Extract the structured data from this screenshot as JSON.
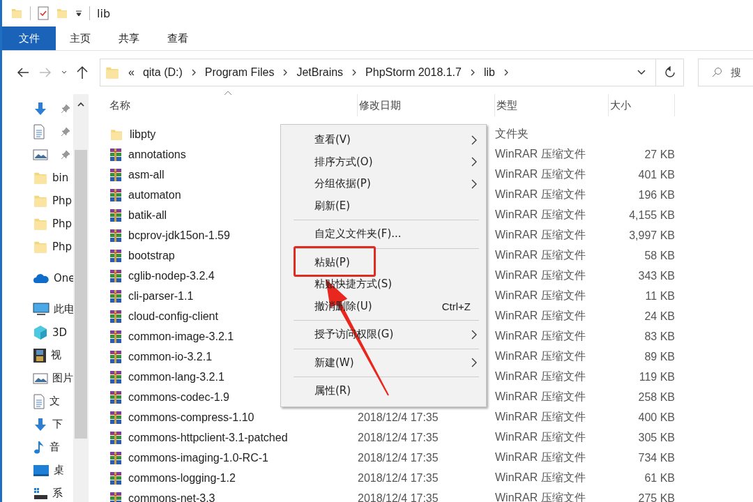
{
  "window": {
    "title": "lib"
  },
  "ribbon_tabs": [
    {
      "label": "文件",
      "selected": true
    },
    {
      "label": "主页",
      "selected": false
    },
    {
      "label": "共享",
      "selected": false
    },
    {
      "label": "查看",
      "selected": false
    }
  ],
  "address": {
    "overflow": "«",
    "segments": [
      "qita (D:)",
      "Program Files",
      "JetBrains",
      "PhpStorm 2018.1.7",
      "lib"
    ]
  },
  "search": {
    "placeholder": "搜"
  },
  "sidebar": {
    "items": [
      {
        "kind": "download",
        "pinned": true
      },
      {
        "kind": "document",
        "pinned": true
      },
      {
        "kind": "picture",
        "pinned": true
      },
      {
        "kind": "folder",
        "label": "bin",
        "pinned": false
      },
      {
        "kind": "folder",
        "label": "Php",
        "pinned": false
      },
      {
        "kind": "folder",
        "label": "Php",
        "pinned": false
      },
      {
        "kind": "folder",
        "label": "Php",
        "pinned": false
      },
      {
        "kind": "cloud",
        "label": "One",
        "pinned": false
      },
      {
        "kind": "computer",
        "label": "此电",
        "pinned": false
      },
      {
        "kind": "cube",
        "label": "3D",
        "pinned": false
      },
      {
        "kind": "video",
        "label": "视",
        "pinned": false
      },
      {
        "kind": "picture",
        "label": "图片",
        "pinned": false
      },
      {
        "kind": "document",
        "label": "文",
        "pinned": false
      },
      {
        "kind": "download",
        "label": "下",
        "pinned": false
      },
      {
        "kind": "music",
        "label": "音",
        "pinned": false
      },
      {
        "kind": "desktop",
        "label": "桌",
        "pinned": false
      },
      {
        "kind": "drive",
        "label": "系",
        "pinned": false
      }
    ]
  },
  "columns": [
    "名称",
    "修改日期",
    "类型",
    "大小"
  ],
  "rows": [
    {
      "kind": "folder",
      "name": "libpty",
      "type": "文件夹"
    },
    {
      "kind": "archive",
      "name": "annotations",
      "type": "WinRAR 压缩文件",
      "size": "27 KB"
    },
    {
      "kind": "archive",
      "name": "asm-all",
      "type": "WinRAR 压缩文件",
      "size": "401 KB"
    },
    {
      "kind": "archive",
      "name": "automaton",
      "type": "WinRAR 压缩文件",
      "size": "196 KB"
    },
    {
      "kind": "archive",
      "name": "batik-all",
      "type": "WinRAR 压缩文件",
      "size": "4,155 KB"
    },
    {
      "kind": "archive",
      "name": "bcprov-jdk15on-1.59",
      "type": "WinRAR 压缩文件",
      "size": "3,997 KB"
    },
    {
      "kind": "archive",
      "name": "bootstrap",
      "type": "WinRAR 压缩文件",
      "size": "58 KB"
    },
    {
      "kind": "archive",
      "name": "cglib-nodep-3.2.4",
      "type": "WinRAR 压缩文件",
      "size": "343 KB"
    },
    {
      "kind": "archive",
      "name": "cli-parser-1.1",
      "type": "WinRAR 压缩文件",
      "size": "11 KB"
    },
    {
      "kind": "archive",
      "name": "cloud-config-client",
      "type": "WinRAR 压缩文件",
      "size": "24 KB"
    },
    {
      "kind": "archive",
      "name": "common-image-3.2.1",
      "type": "WinRAR 压缩文件",
      "size": "83 KB"
    },
    {
      "kind": "archive",
      "name": "common-io-3.2.1",
      "type": "WinRAR 压缩文件",
      "size": "89 KB"
    },
    {
      "kind": "archive",
      "name": "common-lang-3.2.1",
      "type": "WinRAR 压缩文件",
      "size": "119 KB"
    },
    {
      "kind": "archive",
      "name": "commons-codec-1.9",
      "type": "WinRAR 压缩文件",
      "size": "258 KB"
    },
    {
      "kind": "archive",
      "name": "commons-compress-1.10",
      "modified": "2018/12/4 17:35",
      "type": "WinRAR 压缩文件",
      "size": "400 KB"
    },
    {
      "kind": "archive",
      "name": "commons-httpclient-3.1-patched",
      "modified": "2018/12/4 17:35",
      "type": "WinRAR 压缩文件",
      "size": "305 KB"
    },
    {
      "kind": "archive",
      "name": "commons-imaging-1.0-RC-1",
      "modified": "2018/12/4 17:35",
      "type": "WinRAR 压缩文件",
      "size": "734 KB"
    },
    {
      "kind": "archive",
      "name": "commons-logging-1.2",
      "modified": "2018/12/4 17:35",
      "type": "WinRAR 压缩文件",
      "size": "61 KB"
    },
    {
      "kind": "archive",
      "name": "commons-net-3.3",
      "modified": "2018/12/4 17:35",
      "type": "WinRAR 压缩文件",
      "size": "275 KB"
    }
  ],
  "context_menu": {
    "items": [
      {
        "kind": "item",
        "label": "查看(V)",
        "submenu": true,
        "highlighted": false
      },
      {
        "kind": "item",
        "label": "排序方式(O)",
        "submenu": true,
        "highlighted": false
      },
      {
        "kind": "item",
        "label": "分组依据(P)",
        "submenu": true,
        "highlighted": false
      },
      {
        "kind": "item",
        "label": "刷新(E)",
        "submenu": false,
        "highlighted": false
      },
      {
        "kind": "separator"
      },
      {
        "kind": "item",
        "label": "自定义文件夹(F)...",
        "submenu": false,
        "highlighted": false
      },
      {
        "kind": "separator"
      },
      {
        "kind": "item",
        "label": "粘贴(P)",
        "submenu": false,
        "highlighted": true
      },
      {
        "kind": "item",
        "label": "粘贴快捷方式(S)",
        "submenu": false,
        "highlighted": false
      },
      {
        "kind": "item",
        "label": "撤消删除(U)",
        "shortcut": "Ctrl+Z",
        "submenu": false,
        "highlighted": false
      },
      {
        "kind": "separator"
      },
      {
        "kind": "item",
        "label": "授予访问权限(G)",
        "submenu": true,
        "highlighted": false
      },
      {
        "kind": "separator"
      },
      {
        "kind": "item",
        "label": "新建(W)",
        "submenu": true,
        "highlighted": false
      },
      {
        "kind": "separator"
      },
      {
        "kind": "item",
        "label": "属性(R)",
        "submenu": false,
        "highlighted": false
      }
    ]
  }
}
